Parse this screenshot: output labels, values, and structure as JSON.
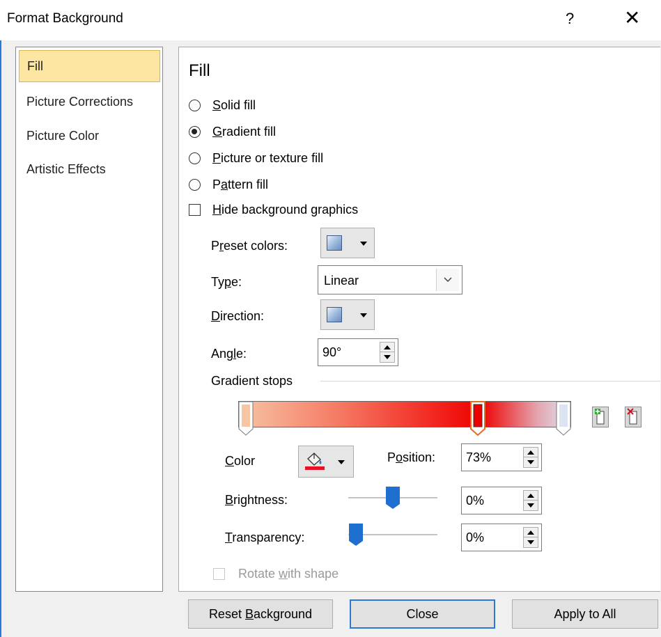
{
  "dialog": {
    "title": "Format Background",
    "help_label": "?",
    "close_label": "✕"
  },
  "sidebar": {
    "items": [
      {
        "label": "Fill",
        "selected": true
      },
      {
        "label": "Picture Corrections",
        "selected": false
      },
      {
        "label": "Picture Color",
        "selected": false
      },
      {
        "label": "Artistic Effects",
        "selected": false
      }
    ]
  },
  "fill": {
    "heading": "Fill",
    "options": {
      "solid": {
        "pre": "",
        "key": "S",
        "post": "olid fill",
        "checked": false
      },
      "gradient": {
        "pre": "",
        "key": "G",
        "post": "radient fill",
        "checked": true
      },
      "picture": {
        "pre": "",
        "key": "P",
        "post": "icture or texture fill",
        "checked": false
      },
      "pattern": {
        "pre": "P",
        "key": "a",
        "post": "ttern fill",
        "checked": false
      }
    },
    "hide_bg": {
      "pre": "",
      "key": "H",
      "post": "ide background graphics",
      "checked": false
    },
    "preset": {
      "pre": "P",
      "key": "r",
      "post": "eset colors:"
    },
    "type": {
      "pre": "Ty",
      "key": "p",
      "post": "e:",
      "value": "Linear"
    },
    "direction": {
      "pre": "",
      "key": "D",
      "post": "irection:"
    },
    "angle": {
      "pre": "Ang",
      "key": "l",
      "post": "e:",
      "value": "90°"
    },
    "gradient_stops_label": "Gradient stops",
    "stops": [
      {
        "position": 0,
        "color": "#f7c4a4",
        "selected": false
      },
      {
        "position": 73,
        "color": "#ef0000",
        "selected": true
      },
      {
        "position": 100,
        "color": "#dce4f2",
        "selected": false
      }
    ],
    "color": {
      "pre": "",
      "key": "C",
      "post": "olor",
      "swatch": "#e81123"
    },
    "position": {
      "pre": "P",
      "key": "o",
      "post": "sition:",
      "value": "73%"
    },
    "brightness": {
      "pre": "",
      "key": "B",
      "post": "rightness:",
      "value": "0%",
      "level": 0
    },
    "transparency": {
      "pre": "",
      "key": "T",
      "post": "ransparency:",
      "value": "0%",
      "level": 0
    },
    "rotate": {
      "pre": "Rotate ",
      "key": "w",
      "post": "ith shape",
      "checked": false,
      "disabled": true
    }
  },
  "footer": {
    "reset": {
      "pre": "Reset ",
      "key": "B",
      "post": "ackground"
    },
    "close": "Close",
    "apply_all": "Apply to All"
  },
  "colors": {
    "accent": "#2b79d6",
    "selected_nav_bg": "#fde6a2",
    "slider_thumb": "#1e6fd0"
  }
}
